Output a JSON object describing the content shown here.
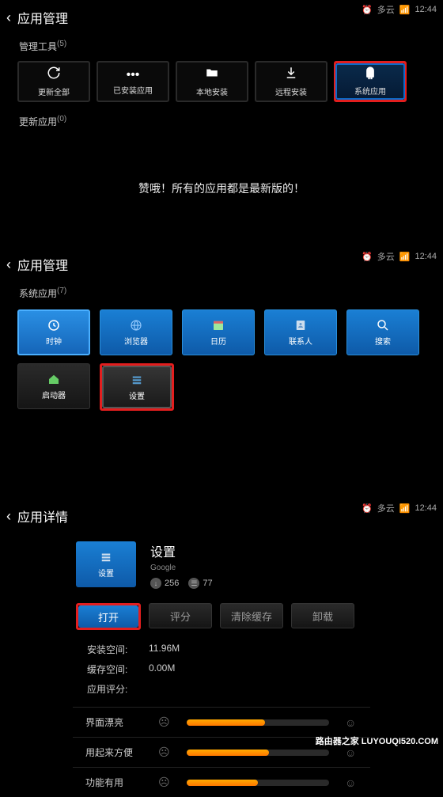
{
  "status": {
    "weather": "多云",
    "time": "12:44"
  },
  "screen1": {
    "title": "应用管理",
    "section": "管理工具",
    "section_count": "(5)",
    "tiles": [
      {
        "label": "更新全部"
      },
      {
        "label": "已安装应用"
      },
      {
        "label": "本地安装"
      },
      {
        "label": "远程安装"
      },
      {
        "label": "系统应用"
      }
    ],
    "update_section": "更新应用",
    "update_count": "(0)",
    "message": "赞哦！所有的应用都是最新版的！"
  },
  "screen2": {
    "title": "应用管理",
    "section": "系统应用",
    "section_count": "(7)",
    "apps": [
      {
        "label": "时钟"
      },
      {
        "label": "浏览器"
      },
      {
        "label": "日历"
      },
      {
        "label": "联系人"
      },
      {
        "label": "搜索"
      },
      {
        "label": "启动器"
      },
      {
        "label": "设置"
      }
    ]
  },
  "screen3": {
    "title": "应用详情",
    "app": {
      "name": "设置",
      "vendor": "Google",
      "icon_label": "设置",
      "stat1": "256",
      "stat2": "77"
    },
    "buttons": {
      "open": "打开",
      "rate": "评分",
      "clear": "清除缓存",
      "uninstall": "卸载"
    },
    "info": {
      "install_label": "安装空间:",
      "install_val": "11.96M",
      "cache_label": "缓存空间:",
      "cache_val": "0.00M",
      "rating_label": "应用评分:"
    },
    "ratings": [
      {
        "label": "界面漂亮",
        "pct": 55
      },
      {
        "label": "用起来方便",
        "pct": 58
      },
      {
        "label": "功能有用",
        "pct": 50
      }
    ]
  },
  "watermark": "路由器之家 LUYOUQI520.COM"
}
